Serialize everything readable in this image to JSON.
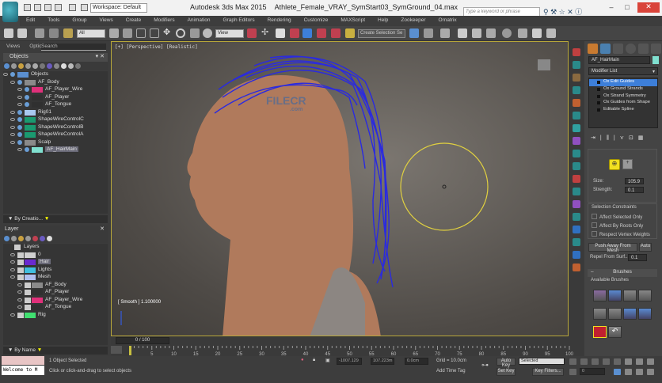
{
  "titlebar": {
    "workspace": "Workspace: Default",
    "title": "Autodesk 3ds Max  2015",
    "filename": "Athlete_Female_VRAY_SymStart03_SymGround_04.max",
    "search_placeholder": "Type a keyword or phrase",
    "minimize": "–",
    "maximize": "□",
    "close": "✕"
  },
  "menu": [
    "Edit",
    "Tools",
    "Group",
    "Views",
    "Create",
    "Modifiers",
    "Animation",
    "Graph Editors",
    "Rendering",
    "Customize",
    "MAXScript",
    "Help",
    "Zookeeper",
    "Ornatrix"
  ],
  "toolbar": {
    "filter": "All",
    "ref_coord": "View",
    "selection_set": "Create Selection Se"
  },
  "explorer": {
    "tabs": [
      "Views",
      "Optio",
      "Search"
    ],
    "title": "Objects",
    "items": [
      {
        "label": "Objects",
        "indent": 0,
        "color": "#5a8fd0"
      },
      {
        "label": "AF_Body",
        "indent": 1,
        "color": "#8a8a8a"
      },
      {
        "label": "AF_Player_Wire",
        "indent": 2,
        "color": "#e0307a"
      },
      {
        "label": "AF_Player",
        "indent": 2,
        "color": "#303030"
      },
      {
        "label": "AF_Tongue",
        "indent": 2,
        "color": "#303030"
      },
      {
        "label": "Rig01",
        "indent": 1,
        "color": "#a8c8f0"
      },
      {
        "label": "ShapeWireControlC",
        "indent": 1,
        "color": "#1a9a70"
      },
      {
        "label": "ShapeWireControlB",
        "indent": 1,
        "color": "#1a9a70"
      },
      {
        "label": "ShapeWireControlA",
        "indent": 1,
        "color": "#1a9a70"
      },
      {
        "label": "Scalp",
        "indent": 1,
        "color": "#8a8a8a"
      },
      {
        "label": "AF_HairMain",
        "indent": 2,
        "color": "#80e0d0",
        "selected": true
      }
    ],
    "filter": "By Creatio..."
  },
  "layers": {
    "title": "Layer",
    "root": "Layers",
    "items": [
      {
        "label": "0",
        "indent": 1,
        "color": "#d0d0d0"
      },
      {
        "label": "Hair",
        "indent": 1,
        "color": "#6a2ad0",
        "selected": true
      },
      {
        "label": "Lights",
        "indent": 1,
        "color": "#40c0e0"
      },
      {
        "label": "Mesh",
        "indent": 1,
        "color": "#b0c0f0"
      },
      {
        "label": "AF_Body",
        "indent": 2,
        "color": "#8a8a8a"
      },
      {
        "label": "AF_Player",
        "indent": 2,
        "color": "#303030"
      },
      {
        "label": "AF_Player_Wire",
        "indent": 2,
        "color": "#e0307a"
      },
      {
        "label": "AF_Tongue",
        "indent": 2,
        "color": "#303030"
      },
      {
        "label": "Rig",
        "indent": 1,
        "color": "#40e070"
      }
    ],
    "filter": "By Name"
  },
  "viewport": {
    "label": "[+] [Perspective] [Realistic]",
    "smooth": "[ Smooth ] 1.100000",
    "watermark": "FILECR",
    "watermark_sub": ".com"
  },
  "command": {
    "object_name": "AF_HairMain",
    "modifier_list": "Modifier List",
    "stack": [
      {
        "label": "Ox Edit Guides",
        "selected": true
      },
      {
        "label": "Ox Ground Strands"
      },
      {
        "label": "Ox Strand Symmetry"
      },
      {
        "label": "Ox Guides from Shape"
      },
      {
        "label": "Editable Spline"
      }
    ],
    "size_label": "Size:",
    "size": "105.9",
    "strength_label": "Strength:",
    "strength": "0.1",
    "constraints_title": "Selection Constraints",
    "affect_selected": "Affect Selected Only",
    "affect_roots": "Affect By Roots Only",
    "respect_weights": "Respect Vertex Weights",
    "push_away": "Push Away From Mesh",
    "auto": "Auto",
    "repel_label": "Repel From Surf...",
    "repel": "0.1",
    "brushes_title": "Brushes",
    "available_brushes": "Available Brushes",
    "collapse": "–"
  },
  "timeline": {
    "slider": "0 / 100",
    "ticks": [
      0,
      5,
      10,
      15,
      20,
      25,
      30,
      35,
      40,
      45,
      50,
      55,
      60,
      65,
      70,
      75,
      80,
      85,
      90,
      95,
      100
    ]
  },
  "status": {
    "welcome": "Welcome to M",
    "selected": "1 Object Selected",
    "prompt": "Click or click-and-drag to select objects",
    "x": "-1007.129",
    "y": "107.223m",
    "z": "0.0cm",
    "grid": "Grid = 10.0cm",
    "add_time_tag": "Add Time Tag",
    "auto_key": "Auto Key",
    "set_key": "Set Key",
    "key_mode": "Selected",
    "key_filters": "Key Filters...",
    "frame": "0"
  }
}
